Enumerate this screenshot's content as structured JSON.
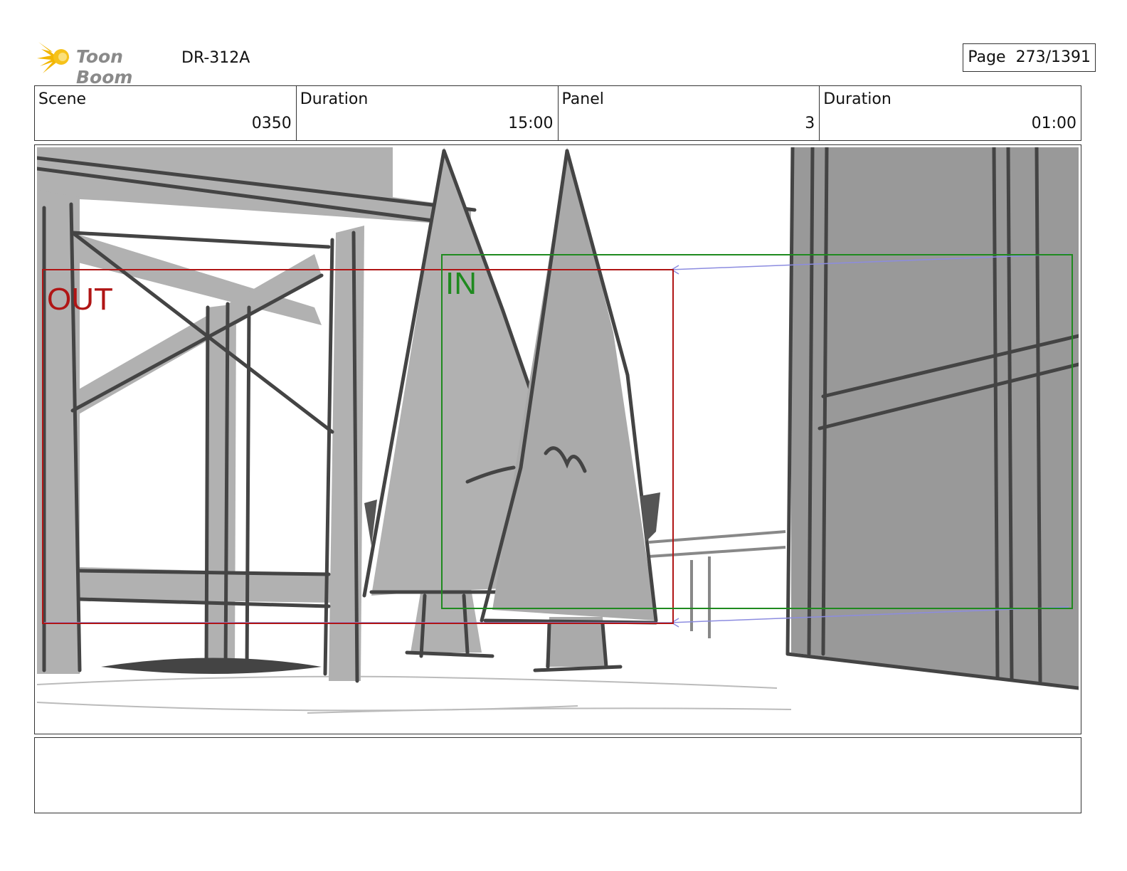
{
  "header": {
    "logo_text": "Toon Boom",
    "production_id": "DR-312A",
    "page_label": "Page",
    "page_value": "273/1391"
  },
  "info": {
    "scene_label": "Scene",
    "scene_value": "0350",
    "scene_duration_label": "Duration",
    "scene_duration_value": "15:00",
    "panel_label": "Panel",
    "panel_value": "3",
    "panel_duration_label": "Duration",
    "panel_duration_value": "01:00"
  },
  "frame": {
    "out_label": "OUT",
    "in_label": "IN",
    "out_color": "#b01515",
    "in_color": "#1f8a1f",
    "motion_color": "#8c8ce0"
  },
  "notes": {
    "text": ""
  }
}
